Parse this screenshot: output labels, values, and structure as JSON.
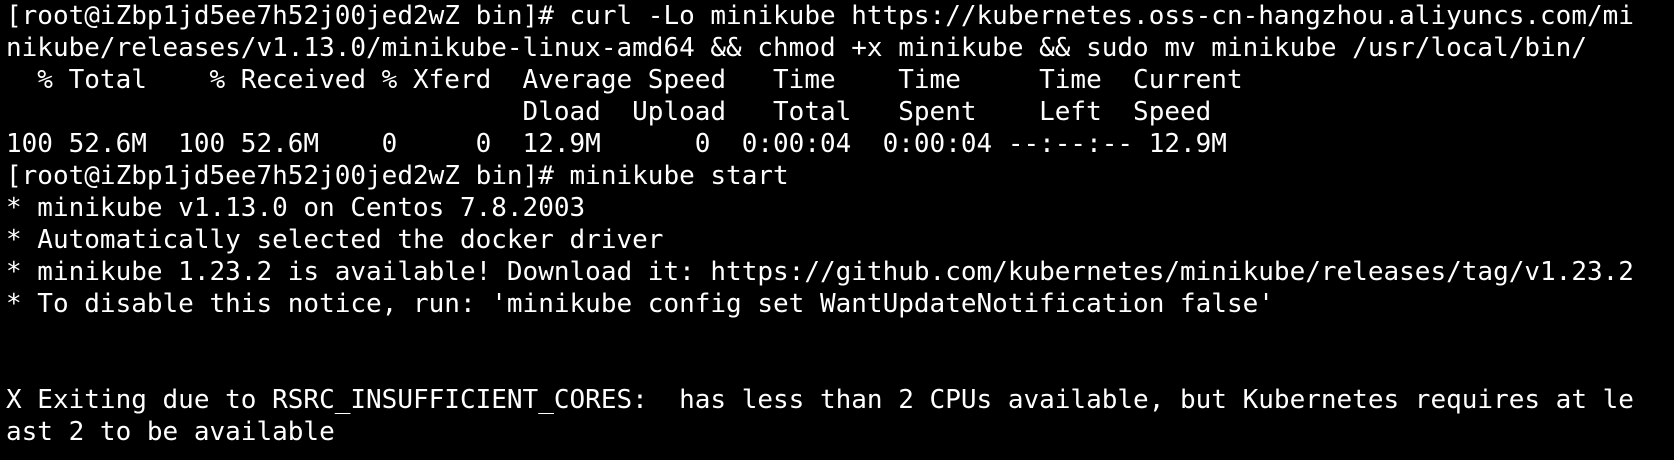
{
  "terminal": {
    "lines": [
      "[root@iZbp1jd5ee7h52j00jed2wZ bin]# curl -Lo minikube https://kubernetes.oss-cn-hangzhou.aliyuncs.com/mi",
      "nikube/releases/v1.13.0/minikube-linux-amd64 && chmod +x minikube && sudo mv minikube /usr/local/bin/",
      "  % Total    % Received % Xferd  Average Speed   Time    Time     Time  Current",
      "                                 Dload  Upload   Total   Spent    Left  Speed",
      "100 52.6M  100 52.6M    0     0  12.9M      0  0:00:04  0:00:04 --:--:-- 12.9M",
      "[root@iZbp1jd5ee7h52j00jed2wZ bin]# minikube start",
      "* minikube v1.13.0 on Centos 7.8.2003",
      "* Automatically selected the docker driver",
      "* minikube 1.23.2 is available! Download it: https://github.com/kubernetes/minikube/releases/tag/v1.23.2",
      "* To disable this notice, run: 'minikube config set WantUpdateNotification false'",
      "",
      "",
      "X Exiting due to RSRC_INSUFFICIENT_CORES:  has less than 2 CPUs available, but Kubernetes requires at le",
      "ast 2 to be available"
    ]
  }
}
